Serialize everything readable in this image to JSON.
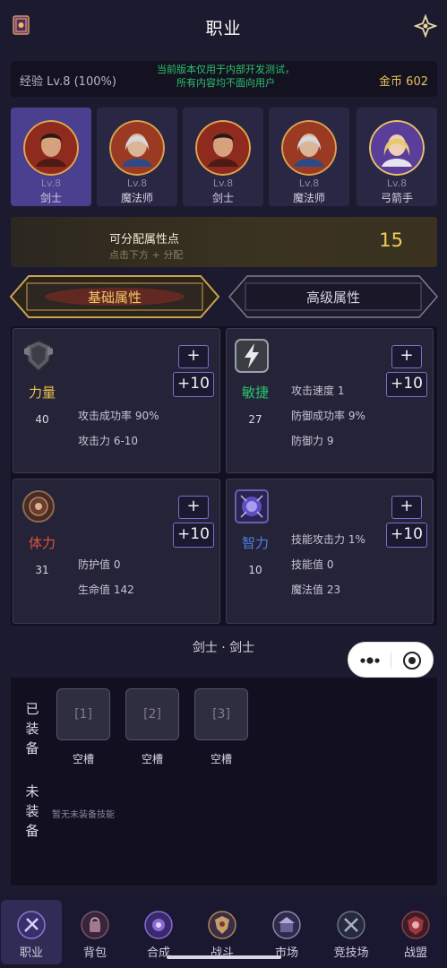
{
  "header": {
    "title": "职业"
  },
  "info": {
    "exp": "经验 Lv.8 (100%)",
    "notice_line1": "当前版本仅用于内部开发测试，",
    "notice_line2": "所有内容均不面向用户",
    "gold": "金币 602"
  },
  "heroes": [
    {
      "level": "Lv.8",
      "name": "剑士",
      "active": true
    },
    {
      "level": "Lv.8",
      "name": "魔法师",
      "active": false
    },
    {
      "level": "Lv.8",
      "name": "剑士",
      "active": false
    },
    {
      "level": "Lv.8",
      "name": "魔法师",
      "active": false
    },
    {
      "level": "Lv.8",
      "name": "弓箭手",
      "active": false
    }
  ],
  "points": {
    "label": "可分配属性点",
    "hint": "点击下方 + 分配",
    "value": "15"
  },
  "tabs": {
    "basic": "基础属性",
    "advanced": "高级属性"
  },
  "attributes": [
    {
      "name": "力量",
      "value": "40",
      "color": "#e8c24a",
      "stats": [
        "攻击成功率 90%",
        "攻击力 6-10"
      ]
    },
    {
      "name": "敏捷",
      "value": "27",
      "color": "#29c46a",
      "stats": [
        "攻击速度 1",
        "防御成功率 9%",
        "防御力 9"
      ]
    },
    {
      "name": "体力",
      "value": "31",
      "color": "#e0533f",
      "stats": [
        "防护值 0",
        "生命值 142"
      ]
    },
    {
      "name": "智力",
      "value": "10",
      "color": "#4f7fe0",
      "stats": [
        "技能攻击力 1%",
        "技能值 0",
        "魔法值 23"
      ]
    }
  ],
  "buttons": {
    "plus": "+",
    "plus10": "+10"
  },
  "class_title": "剑士 · 剑士",
  "skills": {
    "equipped_label": [
      "已",
      "装",
      "备"
    ],
    "unequipped_label": [
      "未",
      "装",
      "备"
    ],
    "slots": [
      {
        "index": "[1]",
        "label": "空槽"
      },
      {
        "index": "[2]",
        "label": "空槽"
      },
      {
        "index": "[3]",
        "label": "空槽"
      }
    ],
    "none_text": "暂无未装备技能"
  },
  "nav": [
    {
      "label": "职业",
      "active": true,
      "icon": "job-icon"
    },
    {
      "label": "背包",
      "active": false,
      "icon": "bag-icon"
    },
    {
      "label": "合成",
      "active": false,
      "icon": "craft-icon"
    },
    {
      "label": "战斗",
      "active": false,
      "icon": "battle-icon"
    },
    {
      "label": "市场",
      "active": false,
      "icon": "market-icon"
    },
    {
      "label": "竞技场",
      "active": false,
      "icon": "arena-icon"
    },
    {
      "label": "战盟",
      "active": false,
      "icon": "guild-icon"
    }
  ]
}
